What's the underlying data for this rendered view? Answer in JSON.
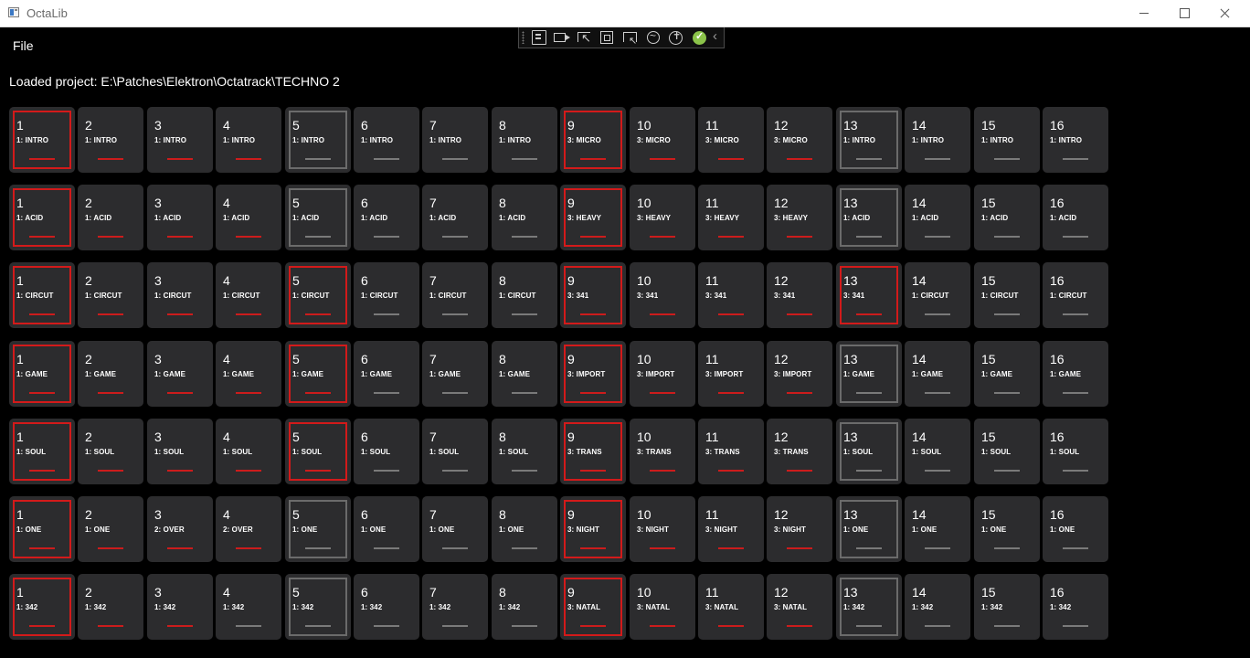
{
  "window": {
    "title": "OctaLib",
    "icon": "app-window-icon",
    "controls": [
      "minimize-icon",
      "maximize-icon",
      "close-icon"
    ]
  },
  "debug_toolbar": {
    "icons": [
      "go-to-live-visual-tree-icon",
      "camera-icon",
      "select-element-icon",
      "display-layout-adorners-icon",
      "track-focused-element-icon",
      "hot-reload-icon",
      "accessibility-icon",
      "hot-reload-ok-icon",
      "collapse-chevron-icon"
    ]
  },
  "menu": {
    "file": "File"
  },
  "project_label": "Loaded project: E:\\Patches\\Elektron\\Octatrack\\TECHNO 2",
  "colors": {
    "active": "#d31a1a",
    "inactive": "#6b6b6b",
    "tile": "#2c2c2e",
    "background": "#000000"
  },
  "grid": [
    [
      {
        "num": "1",
        "name": "1: INTRO",
        "border": "red",
        "bar": "red"
      },
      {
        "num": "2",
        "name": "1: INTRO",
        "border": "none",
        "bar": "red"
      },
      {
        "num": "3",
        "name": "1: INTRO",
        "border": "none",
        "bar": "red"
      },
      {
        "num": "4",
        "name": "1: INTRO",
        "border": "none",
        "bar": "red"
      },
      {
        "num": "5",
        "name": "1: INTRO",
        "border": "grey",
        "bar": "grey"
      },
      {
        "num": "6",
        "name": "1: INTRO",
        "border": "none",
        "bar": "grey"
      },
      {
        "num": "7",
        "name": "1: INTRO",
        "border": "none",
        "bar": "grey"
      },
      {
        "num": "8",
        "name": "1: INTRO",
        "border": "none",
        "bar": "grey"
      },
      {
        "num": "9",
        "name": "3: MICRO",
        "border": "red",
        "bar": "red"
      },
      {
        "num": "10",
        "name": "3: MICRO",
        "border": "none",
        "bar": "red"
      },
      {
        "num": "11",
        "name": "3: MICRO",
        "border": "none",
        "bar": "red"
      },
      {
        "num": "12",
        "name": "3: MICRO",
        "border": "none",
        "bar": "red"
      },
      {
        "num": "13",
        "name": "1: INTRO",
        "border": "grey",
        "bar": "grey"
      },
      {
        "num": "14",
        "name": "1: INTRO",
        "border": "none",
        "bar": "grey"
      },
      {
        "num": "15",
        "name": "1: INTRO",
        "border": "none",
        "bar": "grey"
      },
      {
        "num": "16",
        "name": "1: INTRO",
        "border": "none",
        "bar": "grey"
      }
    ],
    [
      {
        "num": "1",
        "name": "1: ACID",
        "border": "red",
        "bar": "red"
      },
      {
        "num": "2",
        "name": "1: ACID",
        "border": "none",
        "bar": "red"
      },
      {
        "num": "3",
        "name": "1: ACID",
        "border": "none",
        "bar": "red"
      },
      {
        "num": "4",
        "name": "1: ACID",
        "border": "none",
        "bar": "red"
      },
      {
        "num": "5",
        "name": "1: ACID",
        "border": "grey",
        "bar": "grey"
      },
      {
        "num": "6",
        "name": "1: ACID",
        "border": "none",
        "bar": "grey"
      },
      {
        "num": "7",
        "name": "1: ACID",
        "border": "none",
        "bar": "grey"
      },
      {
        "num": "8",
        "name": "1: ACID",
        "border": "none",
        "bar": "grey"
      },
      {
        "num": "9",
        "name": "3: HEAVY",
        "border": "red",
        "bar": "red"
      },
      {
        "num": "10",
        "name": "3: HEAVY",
        "border": "none",
        "bar": "red"
      },
      {
        "num": "11",
        "name": "3: HEAVY",
        "border": "none",
        "bar": "red"
      },
      {
        "num": "12",
        "name": "3: HEAVY",
        "border": "none",
        "bar": "red"
      },
      {
        "num": "13",
        "name": "1: ACID",
        "border": "grey",
        "bar": "grey"
      },
      {
        "num": "14",
        "name": "1: ACID",
        "border": "none",
        "bar": "grey"
      },
      {
        "num": "15",
        "name": "1: ACID",
        "border": "none",
        "bar": "grey"
      },
      {
        "num": "16",
        "name": "1: ACID",
        "border": "none",
        "bar": "grey"
      }
    ],
    [
      {
        "num": "1",
        "name": "1: CIRCUT",
        "border": "red",
        "bar": "red"
      },
      {
        "num": "2",
        "name": "1: CIRCUT",
        "border": "none",
        "bar": "red"
      },
      {
        "num": "3",
        "name": "1: CIRCUT",
        "border": "none",
        "bar": "red"
      },
      {
        "num": "4",
        "name": "1: CIRCUT",
        "border": "none",
        "bar": "red"
      },
      {
        "num": "5",
        "name": "1: CIRCUT",
        "border": "red",
        "bar": "red"
      },
      {
        "num": "6",
        "name": "1: CIRCUT",
        "border": "none",
        "bar": "grey"
      },
      {
        "num": "7",
        "name": "1: CIRCUT",
        "border": "none",
        "bar": "grey"
      },
      {
        "num": "8",
        "name": "1: CIRCUT",
        "border": "none",
        "bar": "grey"
      },
      {
        "num": "9",
        "name": "3: 341",
        "border": "red",
        "bar": "red"
      },
      {
        "num": "10",
        "name": "3: 341",
        "border": "none",
        "bar": "red"
      },
      {
        "num": "11",
        "name": "3: 341",
        "border": "none",
        "bar": "red"
      },
      {
        "num": "12",
        "name": "3: 341",
        "border": "none",
        "bar": "red"
      },
      {
        "num": "13",
        "name": "3: 341",
        "border": "red",
        "bar": "red"
      },
      {
        "num": "14",
        "name": "1: CIRCUT",
        "border": "none",
        "bar": "grey"
      },
      {
        "num": "15",
        "name": "1: CIRCUT",
        "border": "none",
        "bar": "grey"
      },
      {
        "num": "16",
        "name": "1: CIRCUT",
        "border": "none",
        "bar": "grey"
      }
    ],
    [
      {
        "num": "1",
        "name": "1: GAME",
        "border": "red",
        "bar": "red"
      },
      {
        "num": "2",
        "name": "1: GAME",
        "border": "none",
        "bar": "red"
      },
      {
        "num": "3",
        "name": "1: GAME",
        "border": "none",
        "bar": "red"
      },
      {
        "num": "4",
        "name": "1: GAME",
        "border": "none",
        "bar": "red"
      },
      {
        "num": "5",
        "name": "1: GAME",
        "border": "red",
        "bar": "red"
      },
      {
        "num": "6",
        "name": "1: GAME",
        "border": "none",
        "bar": "grey"
      },
      {
        "num": "7",
        "name": "1: GAME",
        "border": "none",
        "bar": "grey"
      },
      {
        "num": "8",
        "name": "1: GAME",
        "border": "none",
        "bar": "grey"
      },
      {
        "num": "9",
        "name": "3: IMPORT",
        "border": "red",
        "bar": "red"
      },
      {
        "num": "10",
        "name": "3: IMPORT",
        "border": "none",
        "bar": "red"
      },
      {
        "num": "11",
        "name": "3: IMPORT",
        "border": "none",
        "bar": "red"
      },
      {
        "num": "12",
        "name": "3: IMPORT",
        "border": "none",
        "bar": "red"
      },
      {
        "num": "13",
        "name": "1: GAME",
        "border": "grey",
        "bar": "grey"
      },
      {
        "num": "14",
        "name": "1: GAME",
        "border": "none",
        "bar": "grey"
      },
      {
        "num": "15",
        "name": "1: GAME",
        "border": "none",
        "bar": "grey"
      },
      {
        "num": "16",
        "name": "1: GAME",
        "border": "none",
        "bar": "grey"
      }
    ],
    [
      {
        "num": "1",
        "name": "1: SOUL",
        "border": "red",
        "bar": "red"
      },
      {
        "num": "2",
        "name": "1: SOUL",
        "border": "none",
        "bar": "red"
      },
      {
        "num": "3",
        "name": "1: SOUL",
        "border": "none",
        "bar": "red"
      },
      {
        "num": "4",
        "name": "1: SOUL",
        "border": "none",
        "bar": "red"
      },
      {
        "num": "5",
        "name": "1: SOUL",
        "border": "red",
        "bar": "red"
      },
      {
        "num": "6",
        "name": "1: SOUL",
        "border": "none",
        "bar": "grey"
      },
      {
        "num": "7",
        "name": "1: SOUL",
        "border": "none",
        "bar": "grey"
      },
      {
        "num": "8",
        "name": "1: SOUL",
        "border": "none",
        "bar": "grey"
      },
      {
        "num": "9",
        "name": "3: TRANS",
        "border": "red",
        "bar": "red"
      },
      {
        "num": "10",
        "name": "3: TRANS",
        "border": "none",
        "bar": "red"
      },
      {
        "num": "11",
        "name": "3: TRANS",
        "border": "none",
        "bar": "red"
      },
      {
        "num": "12",
        "name": "3: TRANS",
        "border": "none",
        "bar": "red"
      },
      {
        "num": "13",
        "name": "1: SOUL",
        "border": "grey",
        "bar": "grey"
      },
      {
        "num": "14",
        "name": "1: SOUL",
        "border": "none",
        "bar": "grey"
      },
      {
        "num": "15",
        "name": "1: SOUL",
        "border": "none",
        "bar": "grey"
      },
      {
        "num": "16",
        "name": "1: SOUL",
        "border": "none",
        "bar": "grey"
      }
    ],
    [
      {
        "num": "1",
        "name": "1: ONE",
        "border": "red",
        "bar": "red"
      },
      {
        "num": "2",
        "name": "1: ONE",
        "border": "none",
        "bar": "red"
      },
      {
        "num": "3",
        "name": "2: OVER",
        "border": "none",
        "bar": "red"
      },
      {
        "num": "4",
        "name": "2: OVER",
        "border": "none",
        "bar": "red"
      },
      {
        "num": "5",
        "name": "1: ONE",
        "border": "grey",
        "bar": "grey"
      },
      {
        "num": "6",
        "name": "1: ONE",
        "border": "none",
        "bar": "grey"
      },
      {
        "num": "7",
        "name": "1: ONE",
        "border": "none",
        "bar": "grey"
      },
      {
        "num": "8",
        "name": "1: ONE",
        "border": "none",
        "bar": "grey"
      },
      {
        "num": "9",
        "name": "3: NIGHT",
        "border": "red",
        "bar": "red"
      },
      {
        "num": "10",
        "name": "3: NIGHT",
        "border": "none",
        "bar": "red"
      },
      {
        "num": "11",
        "name": "3: NIGHT",
        "border": "none",
        "bar": "red"
      },
      {
        "num": "12",
        "name": "3: NIGHT",
        "border": "none",
        "bar": "red"
      },
      {
        "num": "13",
        "name": "1: ONE",
        "border": "grey",
        "bar": "grey"
      },
      {
        "num": "14",
        "name": "1: ONE",
        "border": "none",
        "bar": "grey"
      },
      {
        "num": "15",
        "name": "1: ONE",
        "border": "none",
        "bar": "grey"
      },
      {
        "num": "16",
        "name": "1: ONE",
        "border": "none",
        "bar": "grey"
      }
    ],
    [
      {
        "num": "1",
        "name": "1: 342",
        "border": "red",
        "bar": "red"
      },
      {
        "num": "2",
        "name": "1: 342",
        "border": "none",
        "bar": "red"
      },
      {
        "num": "3",
        "name": "1: 342",
        "border": "none",
        "bar": "red"
      },
      {
        "num": "4",
        "name": "1: 342",
        "border": "none",
        "bar": "grey"
      },
      {
        "num": "5",
        "name": "1: 342",
        "border": "grey",
        "bar": "grey"
      },
      {
        "num": "6",
        "name": "1: 342",
        "border": "none",
        "bar": "grey"
      },
      {
        "num": "7",
        "name": "1: 342",
        "border": "none",
        "bar": "grey"
      },
      {
        "num": "8",
        "name": "1: 342",
        "border": "none",
        "bar": "grey"
      },
      {
        "num": "9",
        "name": "3: NATAL",
        "border": "red",
        "bar": "red"
      },
      {
        "num": "10",
        "name": "3: NATAL",
        "border": "none",
        "bar": "red"
      },
      {
        "num": "11",
        "name": "3: NATAL",
        "border": "none",
        "bar": "red"
      },
      {
        "num": "12",
        "name": "3: NATAL",
        "border": "none",
        "bar": "red"
      },
      {
        "num": "13",
        "name": "1: 342",
        "border": "grey",
        "bar": "grey"
      },
      {
        "num": "14",
        "name": "1: 342",
        "border": "none",
        "bar": "grey"
      },
      {
        "num": "15",
        "name": "1: 342",
        "border": "none",
        "bar": "grey"
      },
      {
        "num": "16",
        "name": "1: 342",
        "border": "none",
        "bar": "grey"
      }
    ]
  ]
}
